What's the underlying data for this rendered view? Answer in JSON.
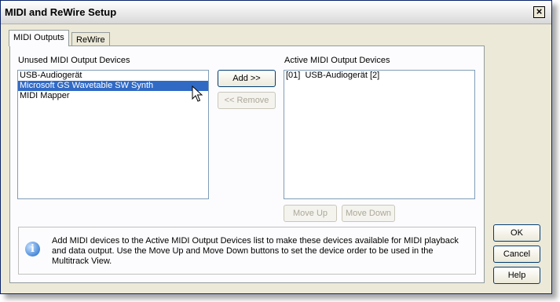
{
  "window": {
    "title": "MIDI and ReWire Setup",
    "close_label": "×"
  },
  "tabs": [
    {
      "label": "MIDI Outputs",
      "active": true
    },
    {
      "label": "ReWire",
      "active": false
    }
  ],
  "unused": {
    "heading": "Unused MIDI Output Devices",
    "items": [
      "USB-Audiogerät",
      "Microsoft GS Wavetable SW Synth",
      "MIDI Mapper"
    ],
    "selected_index": 1
  },
  "active": {
    "heading": "Active MIDI Output Devices",
    "items": [
      "[01]  USB-Audiogerät [2]"
    ]
  },
  "buttons": {
    "add": "Add >>",
    "remove": "<< Remove",
    "move_up": "Move Up",
    "move_down": "Move Down",
    "ok": "OK",
    "cancel": "Cancel",
    "help": "Help"
  },
  "info": {
    "icon": "info-icon",
    "text": "Add MIDI devices to the Active MIDI Output Devices list to make these devices available for MIDI playback and data output. Use the Move Up and Move Down buttons to set the device order to be used in the Multitrack View."
  },
  "colors": {
    "selection": "#316ac5",
    "dialog_bg": "#ece9d8"
  }
}
